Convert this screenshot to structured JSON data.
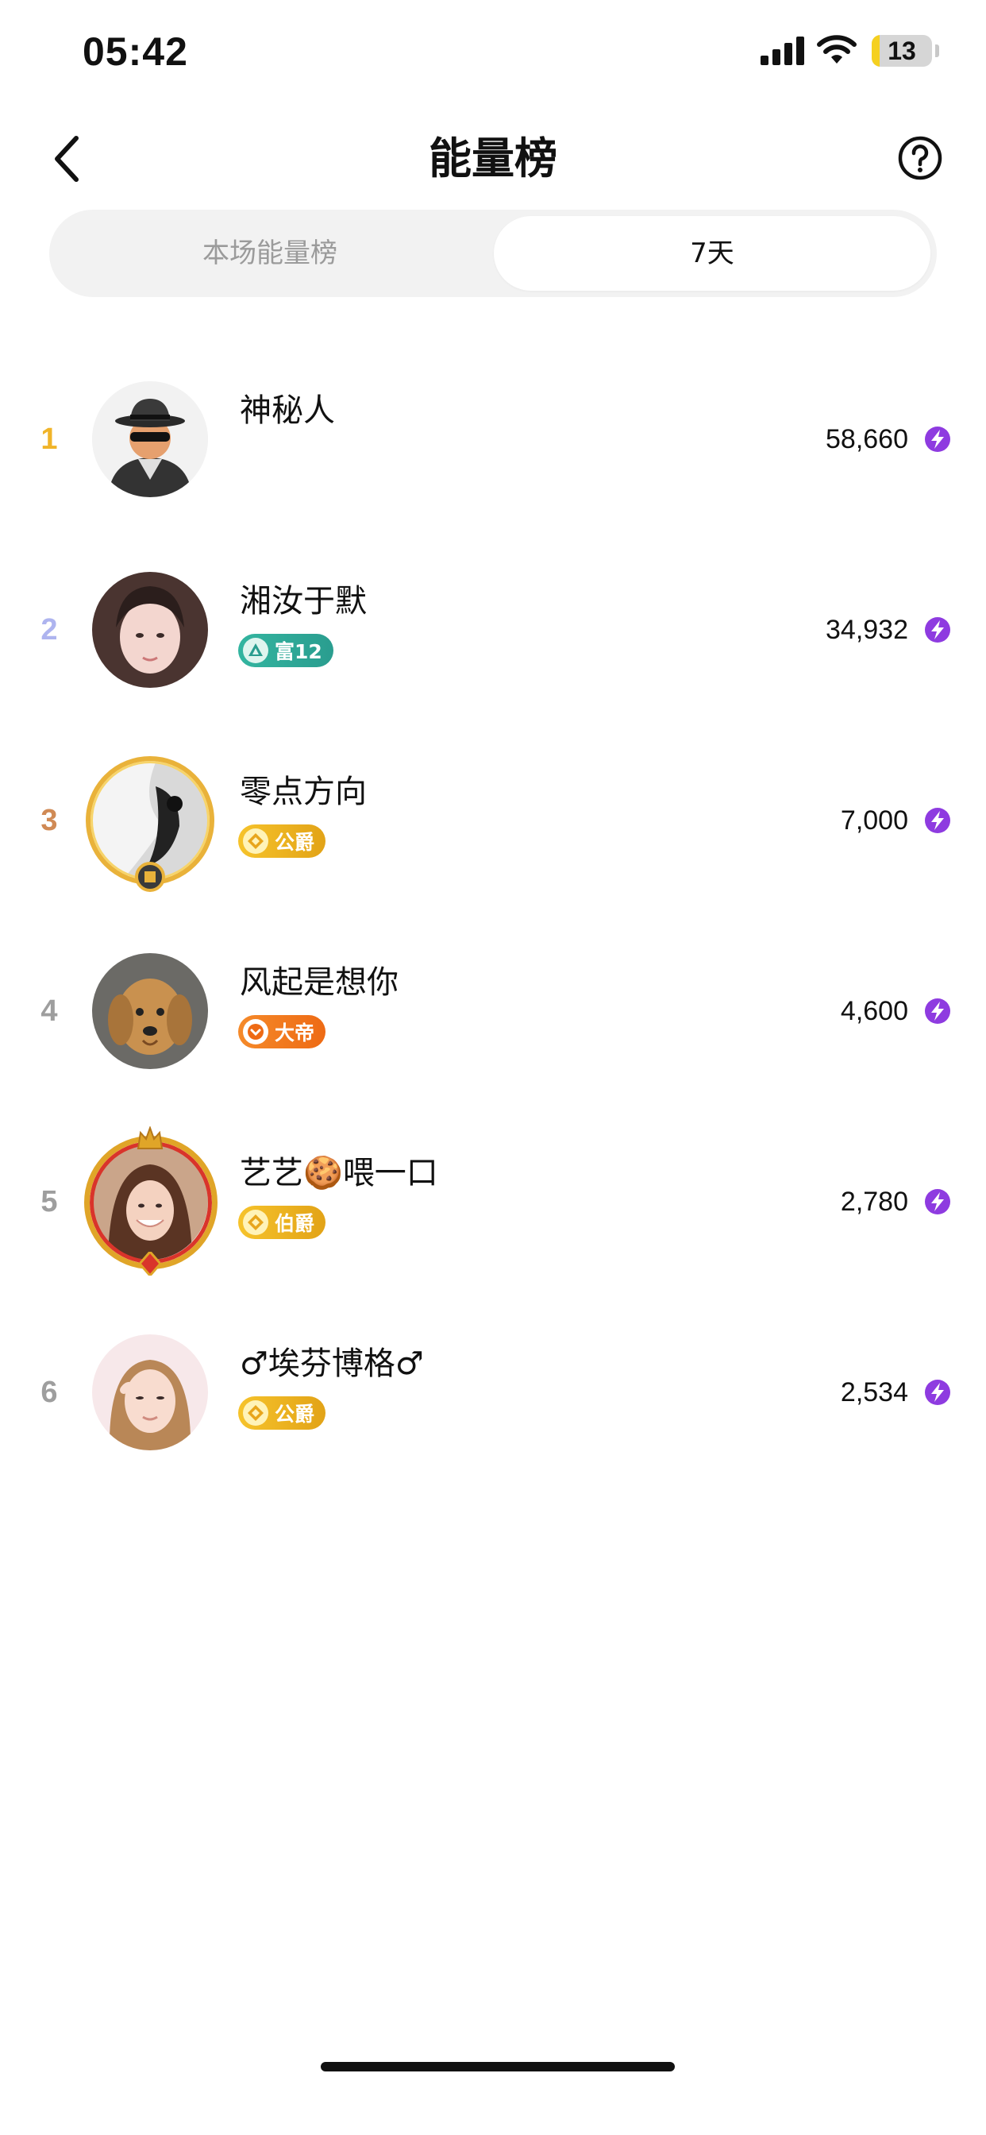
{
  "status_bar": {
    "time": "05:42",
    "battery_level": "13",
    "battery_fraction": 0.13
  },
  "header": {
    "title": "能量榜",
    "back_icon": "chevron-left-icon",
    "help_icon": "question-circle-icon"
  },
  "tabs": [
    {
      "label": "本场能量榜",
      "selected": false
    },
    {
      "label": "7天",
      "selected": true
    }
  ],
  "colors": {
    "rank1": "#F0B429",
    "rank2": "#AEB4EF",
    "rank3": "#D08A55",
    "rank_other": "#9E9E9E",
    "energy": "#8E3BE0"
  },
  "ranking": [
    {
      "rank": "1",
      "name": "神秘人",
      "score": "58,660",
      "badge": null,
      "avatar": "mystery-person-avatar"
    },
    {
      "rank": "2",
      "name": "湘汝于默",
      "score": "34,932",
      "badge": {
        "label": "富12",
        "type": "wealth"
      },
      "avatar": "user-avatar"
    },
    {
      "rank": "3",
      "name": "零点方向",
      "score": "7,000",
      "badge": {
        "label": "公爵",
        "type": "noble"
      },
      "avatar": "user-avatar"
    },
    {
      "rank": "4",
      "name": "风起是想你",
      "score": "4,600",
      "badge": {
        "label": "大帝",
        "type": "emperor"
      },
      "avatar": "dog-avatar"
    },
    {
      "rank": "5",
      "name": "艺艺🍪喂一口",
      "score": "2,780",
      "badge": {
        "label": "伯爵",
        "type": "noble"
      },
      "avatar": "user-avatar"
    },
    {
      "rank": "6",
      "name": "♂埃芬博格♂",
      "score": "2,534",
      "badge": {
        "label": "公爵",
        "type": "noble"
      },
      "avatar": "user-avatar"
    }
  ]
}
